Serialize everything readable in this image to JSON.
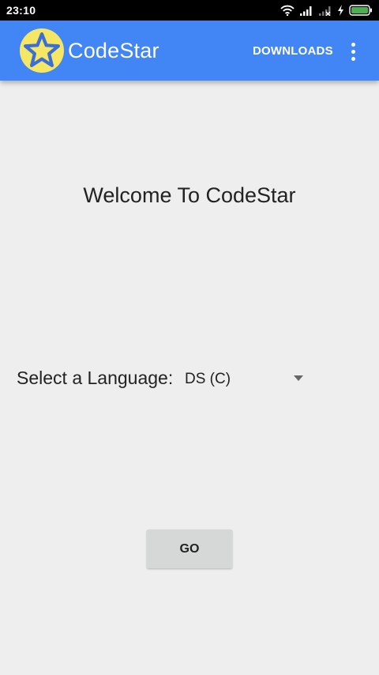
{
  "status_bar": {
    "time": "23:10",
    "icons": [
      "wifi-icon",
      "signal-icon",
      "no-signal-icon",
      "charging-icon",
      "battery-icon"
    ],
    "battery_color": "#4caf50"
  },
  "app_bar": {
    "title": "CodeStar",
    "logo_icon": "star-icon",
    "actions": {
      "downloads_label": "DOWNLOADS",
      "overflow_icon": "more-vert-icon"
    },
    "color": "#4285f4"
  },
  "main": {
    "welcome_text": "Welcome To CodeStar",
    "language_label": "Select a Language:",
    "language_selected": "DS (C)",
    "go_label": "GO"
  },
  "colors": {
    "background": "#eeeeee",
    "logo_circle": "#f5e663",
    "logo_star": "#3a6fd8"
  }
}
